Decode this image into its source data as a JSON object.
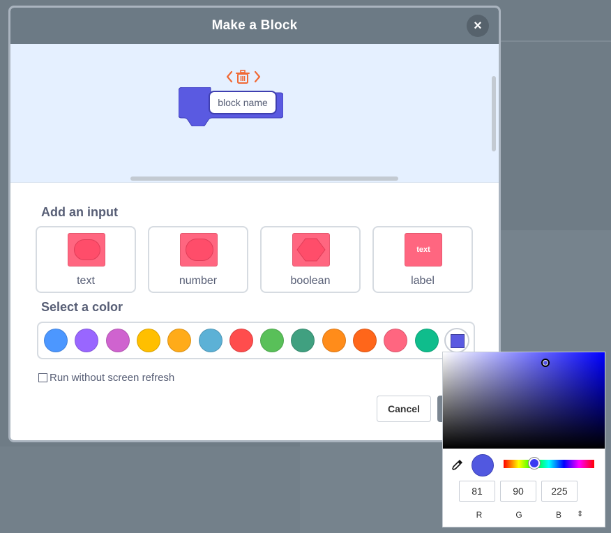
{
  "modal": {
    "title": "Make a Block",
    "close_glyph": "×",
    "block_name_value": "block name"
  },
  "add_input": {
    "title": "Add an input",
    "cards": [
      {
        "label": "text",
        "icon": "text-input-icon"
      },
      {
        "label": "number",
        "icon": "number-input-icon"
      },
      {
        "label": "boolean",
        "icon": "boolean-input-icon"
      },
      {
        "label": "label",
        "icon": "label-icon",
        "swatch_text": "text"
      }
    ]
  },
  "select_color": {
    "title": "Select a color",
    "colors": [
      "#4c97ff",
      "#9966ff",
      "#cf63cf",
      "#ffbf00",
      "#ffab19",
      "#5cb1d6",
      "#ff4d4d",
      "#59c059",
      "#40a080",
      "#ff8c1a",
      "#ff661a",
      "#ff6680",
      "#0fbd8c"
    ],
    "custom_color": "#5a5ae1"
  },
  "options": {
    "run_without_refresh_label": "Run without screen refresh",
    "run_without_refresh_checked": false
  },
  "buttons": {
    "cancel_label": "Cancel"
  },
  "color_picker": {
    "r": "81",
    "g": "90",
    "b": "225",
    "r_label": "R",
    "g_label": "G",
    "b_label": "B",
    "mode_toggle_glyph": "⇕",
    "preview_color": "#5158e0"
  },
  "colors": {
    "header_bg": "#6c7a85",
    "block_color": "#5a5ae1",
    "input_swatch": "#ff6680",
    "workspace_bg": "#e5f0ff"
  }
}
